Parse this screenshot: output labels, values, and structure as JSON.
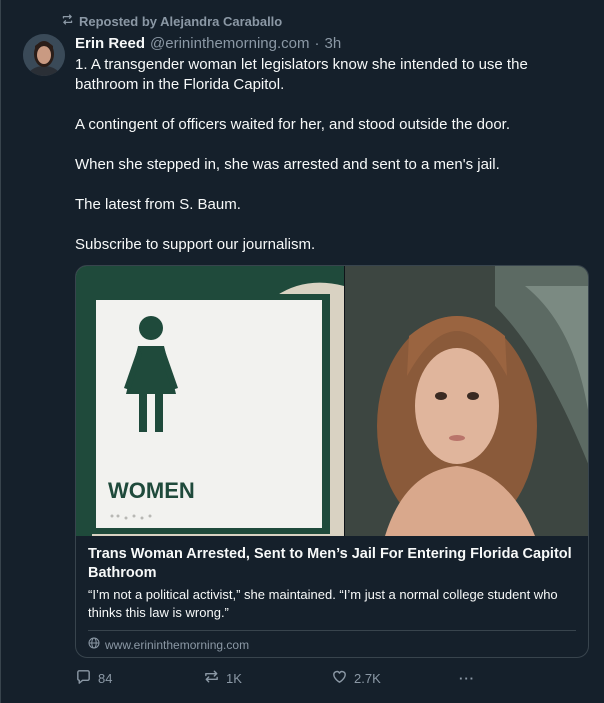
{
  "repost": {
    "label": "Reposted by Alejandra Caraballo"
  },
  "author": {
    "display_name": "Erin Reed",
    "handle": "@erininthemorning.com",
    "separator": "·",
    "time": "3h"
  },
  "post": {
    "paragraphs": [
      "1. A transgender woman let legislators know she intended to use the bathroom in the Florida Capitol.",
      "A contingent of officers waited for her, and stood outside the door.",
      "When she stepped in, she was arrested and sent to a men's jail.",
      "The latest from S. Baum.",
      "Subscribe to support our journalism."
    ]
  },
  "link_card": {
    "sign_text": "WOMEN",
    "title": "Trans Woman Arrested, Sent to Men’s Jail For Entering Florida Capitol Bathroom",
    "description": "“I’m not a political activist,” she maintained. “I’m just a normal college student who thinks this law is wrong.”",
    "domain": "www.erininthemorning.com"
  },
  "actions": {
    "reply_count": "84",
    "repost_count": "1K",
    "like_count": "2.7K",
    "more_label": "···"
  },
  "colors": {
    "background": "#15202b",
    "text": "#f7f9f9",
    "muted": "#8b98a5",
    "border": "#38444d",
    "sign_green": "#1f4a3b"
  }
}
